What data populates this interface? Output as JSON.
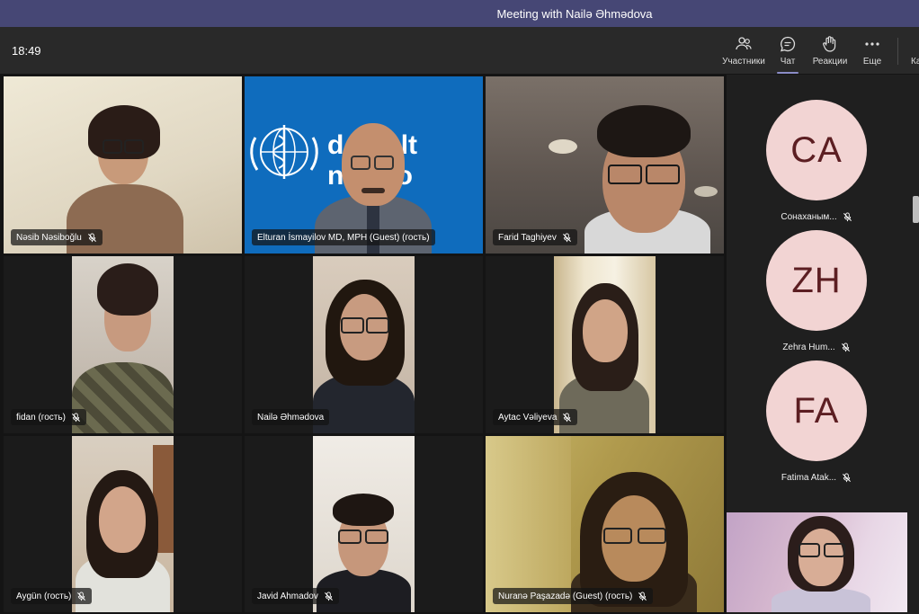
{
  "window": {
    "title": "Meeting with Nailə Əhmədova"
  },
  "toolbar": {
    "clock": "18:49",
    "participants_label": "Участники",
    "chat_label": "Чат",
    "reactions_label": "Реакции",
    "more_label": "Еще",
    "cut_label": "Ка"
  },
  "tiles": [
    {
      "name": "Nəsib Nəsiboğlu"
    },
    {
      "name": "Elturan İsmayilov MD, MPH (Guest) (гость)"
    },
    {
      "name": "Farid Taghiyev"
    },
    {
      "name": "fidan (гость)"
    },
    {
      "name": "Nailə Əhmədova"
    },
    {
      "name": "Aytac Vəliyeva"
    },
    {
      "name": "Aygün (гость)"
    },
    {
      "name": "Javid Ahmadov"
    },
    {
      "name": "Nuranə Paşazadə (Guest) (гость)"
    }
  ],
  "who_banner": {
    "line1": "d Healt",
    "line2": "nizatio"
  },
  "roster": [
    {
      "initials": "CA",
      "name": "Сонаханым..."
    },
    {
      "initials": "ZH",
      "name": "Zehra Hum..."
    },
    {
      "initials": "FA",
      "name": "Fatima Atak..."
    }
  ],
  "colors": {
    "titlebar": "#464775",
    "avatar_bg": "#f2d4d3",
    "avatar_text": "#5c1e22",
    "active_tab": "#8b8cc7"
  }
}
